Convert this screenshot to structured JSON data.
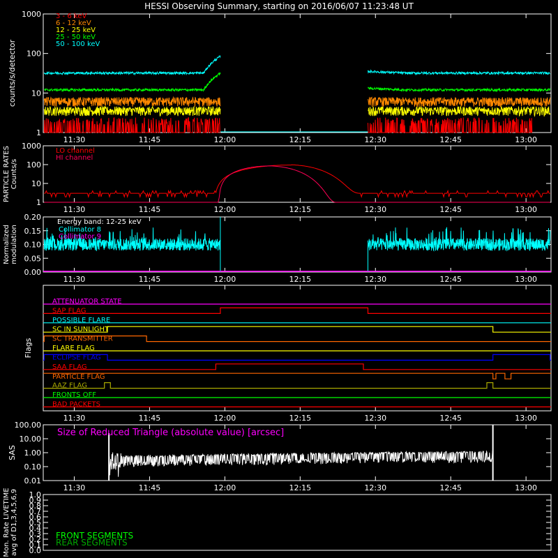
{
  "title": "HESSI Observing Summary, starting on 2016/06/07 11:23:48 UT",
  "colors": {
    "bg": "#000000",
    "axis": "#ffffff",
    "red": "#ff0000",
    "orange": "#ff8800",
    "yellow": "#ffff00",
    "green": "#00ff00",
    "cyan": "#00ffff",
    "magenta": "#ff00ff",
    "crimson": "#ff0055",
    "blue": "#0000ff",
    "darkgreen": "#00aa00",
    "olive": "#aaaa00",
    "darkorange": "#ff6600"
  },
  "chart_data": [
    {
      "panel": "counts",
      "type": "line",
      "ylabel": "counts/s/detector",
      "yscale": "log",
      "ylim": [
        1,
        1000
      ],
      "y_ticks": [
        "1",
        "10",
        "100",
        "1000"
      ],
      "x_ticks": [
        "11:30",
        "11:45",
        "12:00",
        "12:15",
        "12:30",
        "12:45",
        "13:00"
      ],
      "legend_placement": "top-left",
      "series": [
        {
          "name": "3 - 6 keV",
          "color": "red",
          "segments": [
            [
              11.4,
              11.985
            ],
            [
              12.475,
              13.02
            ]
          ],
          "level": 1.3,
          "style": "spiky-low"
        },
        {
          "name": "6 - 12 keV",
          "color": "orange",
          "segments": [
            [
              11.4,
              11.985
            ],
            [
              12.475,
              13.08
            ]
          ],
          "level": 6,
          "style": "noisy"
        },
        {
          "name": "12 - 25 keV",
          "color": "yellow",
          "segments": [
            [
              11.4,
              11.985
            ],
            [
              12.475,
              13.08
            ]
          ],
          "level": 3.5,
          "style": "noisy"
        },
        {
          "name": "25 - 50 keV",
          "color": "green",
          "segments": [
            [
              11.4,
              11.985
            ],
            [
              12.475,
              13.08
            ]
          ],
          "level": 12,
          "style": "smooth"
        },
        {
          "name": "50 - 100 keV",
          "color": "cyan",
          "segments": [
            [
              11.4,
              11.985
            ],
            [
              12.475,
              13.08
            ]
          ],
          "level": 32,
          "style": "smooth"
        }
      ]
    },
    {
      "panel": "particle",
      "type": "line",
      "ylabel_lines": [
        "PARTICLE RATES",
        "Counts/s"
      ],
      "yscale": "log",
      "ylim": [
        1,
        1000
      ],
      "y_ticks": [
        "1",
        "10",
        "100",
        "1000"
      ],
      "x_ticks": [
        "11:30",
        "11:45",
        "12:00",
        "12:15",
        "12:30",
        "12:45",
        "13:00"
      ],
      "series": [
        {
          "name": "LO channel",
          "color": "red",
          "baseline": 3,
          "peak": 95,
          "rise": 11.97,
          "top": 12.22,
          "fall": 12.45
        },
        {
          "name": "HI channel",
          "color": "crimson",
          "baseline": 1,
          "peak": 85,
          "rise": 11.98,
          "top": 12.15,
          "fall": 12.37
        }
      ]
    },
    {
      "panel": "modulation",
      "type": "line",
      "ylabel_lines": [
        "Normalized",
        "modulation"
      ],
      "ylim": [
        0.0,
        0.2
      ],
      "y_ticks": [
        "0.00",
        "0.05",
        "0.10",
        "0.15",
        "0.20"
      ],
      "x_ticks": [
        "11:30",
        "11:45",
        "12:00",
        "12:15",
        "12:30",
        "12:45",
        "13:00"
      ],
      "annotation": "Energy band: 12-25 keV",
      "series": [
        {
          "name": "Collimator 8",
          "color": "cyan",
          "segments": [
            [
              11.4,
              11.985
            ],
            [
              12.475,
              13.08
            ]
          ],
          "level": 0.1
        },
        {
          "name": "Collimator 9",
          "color": "magenta",
          "level": 0.0
        }
      ]
    },
    {
      "panel": "flags",
      "type": "step",
      "ylabel": "Flags",
      "x_ticks": [
        "11:30",
        "11:45",
        "12:00",
        "12:15",
        "12:30",
        "12:45",
        "13:00"
      ],
      "series": [
        {
          "name": "ATTENUATOR STATE",
          "color": "magenta",
          "steps": []
        },
        {
          "name": "SAP FLAG",
          "color": "red",
          "steps": [
            [
              11.985,
              12.475
            ]
          ]
        },
        {
          "name": "POSSIBLE FLARE",
          "color": "cyan",
          "steps": []
        },
        {
          "name": "SC IN SUNLIGHT",
          "color": "yellow",
          "steps": [
            [
              11.61,
              12.89
            ]
          ],
          "low_offset": 1
        },
        {
          "name": "SC TRANSMITTER",
          "color": "darkorange",
          "steps": [
            [
              11.4,
              11.74
            ]
          ]
        },
        {
          "name": "FLARE FLAG",
          "color": "yellow",
          "steps": []
        },
        {
          "name": "ECLIPSE FLAG",
          "color": "blue",
          "steps": [
            [
              11.4,
              11.61
            ],
            [
              12.89,
              13.08
            ]
          ]
        },
        {
          "name": "SAA FLAG",
          "color": "red",
          "steps": [
            [
              11.97,
              12.46
            ]
          ]
        },
        {
          "name": "PARTICLE FLAG",
          "color": "darkorange",
          "steps": [
            [
              12.89,
              12.9
            ],
            [
              12.93,
              12.95
            ]
          ],
          "inverted": true
        },
        {
          "name": "AAZ FLAG",
          "color": "olive",
          "steps": [
            [
              11.6,
              11.62
            ],
            [
              12.87,
              12.89
            ]
          ]
        },
        {
          "name": "FRONTS OFF",
          "color": "green",
          "steps": []
        },
        {
          "name": "BAD PACKETS",
          "color": "red",
          "steps": []
        }
      ]
    },
    {
      "panel": "sas",
      "type": "line",
      "ylabel": "SAS",
      "yscale": "log",
      "ylim": [
        0.01,
        100
      ],
      "y_ticks": [
        "0.01",
        "0.10",
        "1.00",
        "10.00",
        "100.00"
      ],
      "x_ticks": [
        "11:30",
        "11:45",
        "12:00",
        "12:15",
        "12:30",
        "12:45",
        "13:00"
      ],
      "annotation": "Size of Reduced Triangle (absolute value) [arcsec]",
      "series": [
        {
          "name": "SAS",
          "color": "axis",
          "range": [
            11.615,
            12.89
          ]
        }
      ]
    },
    {
      "panel": "livetime",
      "type": "line",
      "ylabel_lines": [
        "Mon. Rate LIVETIME",
        "avg of D1,3,4,5,6,9"
      ],
      "ylim": [
        0.0,
        1.0
      ],
      "y_ticks": [
        "0.0",
        "0.1",
        "0.2",
        "0.3",
        "0.4",
        "0.5",
        "0.6",
        "0.7",
        "0.8",
        "0.9",
        "1.0"
      ],
      "series": [
        {
          "name": "FRONT SEGMENTS",
          "color": "green"
        },
        {
          "name": "REAR SEGMENTS",
          "color": "darkgreen"
        }
      ]
    }
  ]
}
